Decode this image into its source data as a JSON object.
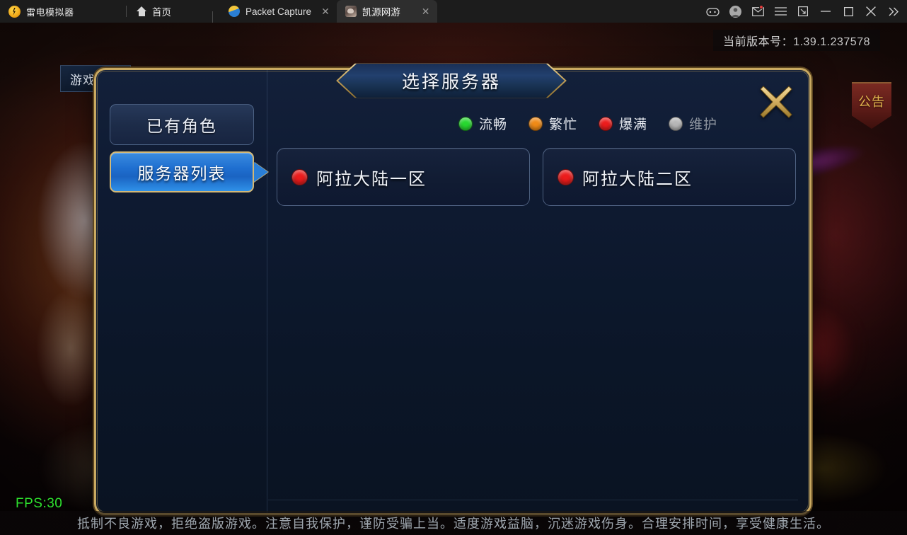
{
  "titlebar": {
    "brand": "雷电模拟器",
    "home_label": "首页",
    "tabs": [
      {
        "label": "Packet Capture",
        "close": "✕",
        "active": false,
        "icon": "packet-capture-icon"
      },
      {
        "label": "凯源网游",
        "close": "✕",
        "active": true,
        "icon": "game-icon"
      }
    ],
    "right_icons": [
      {
        "name": "gamepad-icon"
      },
      {
        "name": "account-avatar-icon"
      },
      {
        "name": "mail-icon",
        "badge": true
      },
      {
        "name": "menu-icon"
      },
      {
        "name": "resize-icon"
      },
      {
        "name": "minimize-icon"
      },
      {
        "name": "maximize-icon"
      },
      {
        "name": "close-icon"
      },
      {
        "name": "expand-right-icon"
      }
    ]
  },
  "overlay": {
    "version_text": "当前版本号：1.39.1.237578",
    "guide_button": "游戏攻略",
    "notice_banner": "公告"
  },
  "dialog": {
    "title": "选择服务器",
    "close_label": "关闭",
    "sidebar": {
      "tabs": [
        {
          "label": "已有角色",
          "selected": false
        },
        {
          "label": "服务器列表",
          "selected": true
        }
      ]
    },
    "legend": [
      {
        "label": "流畅",
        "color": "#27d82f",
        "text_color": "#e6eaf0"
      },
      {
        "label": "繁忙",
        "color": "#f08a16",
        "text_color": "#e6eaf0"
      },
      {
        "label": "爆满",
        "color": "#ec1c1c",
        "text_color": "#e6eaf0"
      },
      {
        "label": "维护",
        "color": "#b7b7b7",
        "text_color": "#8d949e"
      }
    ],
    "servers": [
      {
        "name": "阿拉大陆一区",
        "status": "爆满",
        "color": "#ec1c1c"
      },
      {
        "name": "阿拉大陆二区",
        "status": "爆满",
        "color": "#ec1c1c"
      }
    ]
  },
  "footer": {
    "fps": "FPS:30",
    "notice": "抵制不良游戏，拒绝盗版游戏。注意自我保护，谨防受骗上当。适度游戏益脑，沉迷游戏伤身。合理安排时间，享受健康生活。"
  }
}
